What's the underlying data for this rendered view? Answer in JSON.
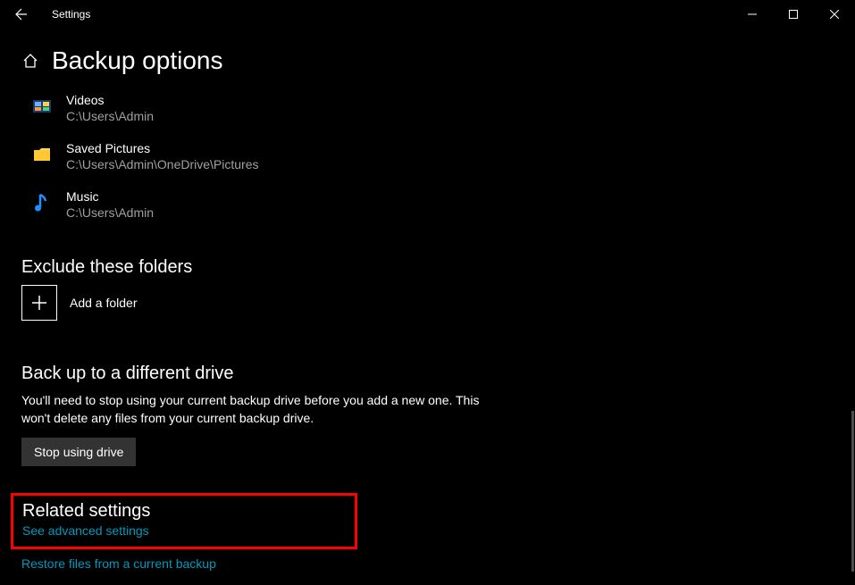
{
  "window": {
    "title": "Settings"
  },
  "page": {
    "title": "Backup options"
  },
  "folders": [
    {
      "name": "Videos",
      "path": "C:\\Users\\Admin"
    },
    {
      "name": "Saved Pictures",
      "path": "C:\\Users\\Admin\\OneDrive\\Pictures"
    },
    {
      "name": "Music",
      "path": "C:\\Users\\Admin"
    }
  ],
  "exclude": {
    "heading": "Exclude these folders",
    "add_label": "Add a folder"
  },
  "different_drive": {
    "heading": "Back up to a different drive",
    "body": "You'll need to stop using your current backup drive before you add a new one. This won't delete any files from your current backup drive.",
    "button": "Stop using drive"
  },
  "related": {
    "heading": "Related settings",
    "link1": "See advanced settings",
    "link2": "Restore files from a current backup"
  }
}
